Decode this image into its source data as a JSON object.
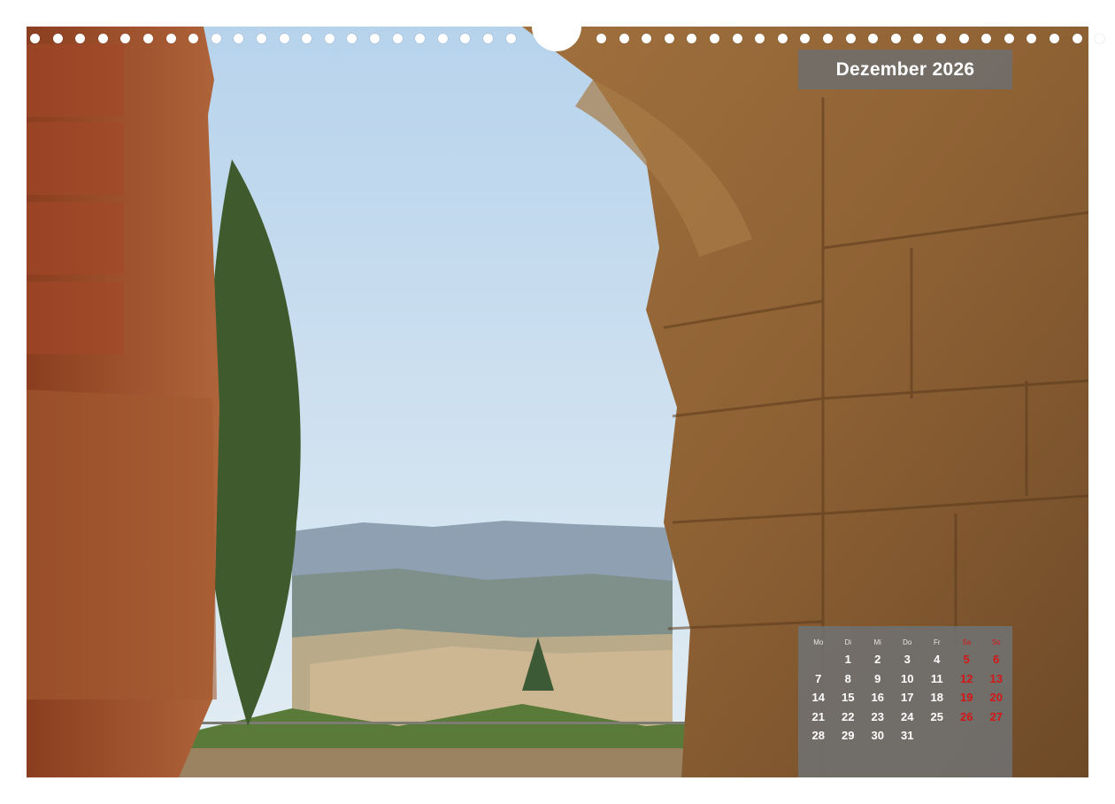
{
  "calendar": {
    "title": "Dezember 2026",
    "weekdays": [
      "Mo",
      "Di",
      "Mi",
      "Do",
      "Fr",
      "Sa",
      "So"
    ],
    "weeks": [
      [
        "",
        "1",
        "2",
        "3",
        "4",
        "5",
        "6"
      ],
      [
        "7",
        "8",
        "9",
        "10",
        "11",
        "12",
        "13"
      ],
      [
        "14",
        "15",
        "16",
        "17",
        "18",
        "19",
        "20"
      ],
      [
        "21",
        "22",
        "23",
        "24",
        "25",
        "26",
        "27"
      ],
      [
        "28",
        "29",
        "30",
        "31",
        "",
        "",
        ""
      ]
    ]
  },
  "colors": {
    "weekend": "#d51616",
    "panel": "#707070",
    "text": "#ffffff"
  },
  "photo": {
    "subject": "stone arch view over tuscan hills"
  }
}
